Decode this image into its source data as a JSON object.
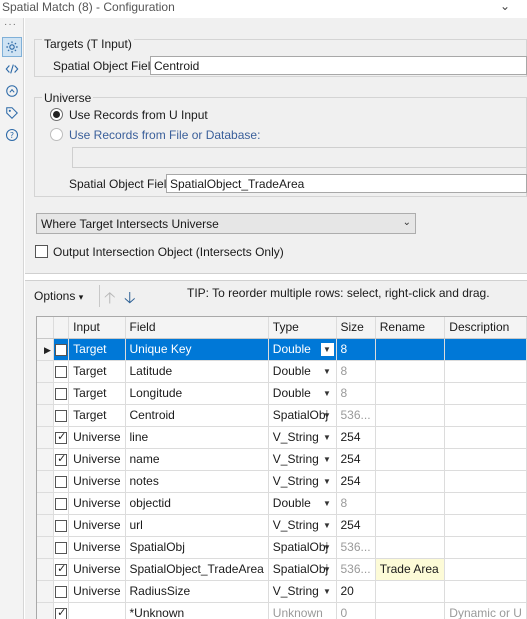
{
  "window": {
    "title": "Spatial Match (8) - Configuration"
  },
  "sidebar": {
    "icons": [
      "gear-icon",
      "code-icon",
      "help-circle-icon",
      "tag-icon",
      "question-icon"
    ]
  },
  "targets": {
    "group_title": "Targets (T Input)",
    "field_label": "Spatial Object Field:",
    "field_value": "Centroid"
  },
  "universe": {
    "group_title": "Universe",
    "option_u_input": "Use Records from U Input",
    "option_file": "Use Records from File or Database:",
    "file_value": "",
    "field_label": "Spatial Object Field:",
    "field_value": "SpatialObject_TradeArea"
  },
  "match_type": {
    "selected": "Where Target Intersects Universe"
  },
  "output_intersection": {
    "label": "Output Intersection Object (Intersects Only)",
    "checked": false
  },
  "toolbar": {
    "options_label": "Options",
    "tip": "TIP: To reorder multiple rows: select, right-click and drag."
  },
  "table": {
    "columns": [
      "Input",
      "Field",
      "Type",
      "Size",
      "Rename",
      "Description"
    ],
    "rows": [
      {
        "checked": false,
        "input": "Target",
        "field": "Unique Key",
        "type": "Double",
        "size": "8",
        "rename": "",
        "description": "",
        "selected": true
      },
      {
        "checked": false,
        "input": "Target",
        "field": "Latitude",
        "type": "Double",
        "size": "8",
        "rename": "",
        "description": ""
      },
      {
        "checked": false,
        "input": "Target",
        "field": "Longitude",
        "type": "Double",
        "size": "8",
        "rename": "",
        "description": ""
      },
      {
        "checked": false,
        "input": "Target",
        "field": "Centroid",
        "type": "SpatialObj",
        "size": "536...",
        "rename": "",
        "description": ""
      },
      {
        "checked": true,
        "input": "Universe",
        "field": "line",
        "type": "V_String",
        "size": "254",
        "rename": "",
        "description": ""
      },
      {
        "checked": true,
        "input": "Universe",
        "field": "name",
        "type": "V_String",
        "size": "254",
        "rename": "",
        "description": ""
      },
      {
        "checked": false,
        "input": "Universe",
        "field": "notes",
        "type": "V_String",
        "size": "254",
        "rename": "",
        "description": ""
      },
      {
        "checked": false,
        "input": "Universe",
        "field": "objectid",
        "type": "Double",
        "size": "8",
        "rename": "",
        "description": ""
      },
      {
        "checked": false,
        "input": "Universe",
        "field": "url",
        "type": "V_String",
        "size": "254",
        "rename": "",
        "description": ""
      },
      {
        "checked": false,
        "input": "Universe",
        "field": "SpatialObj",
        "type": "SpatialObj",
        "size": "536...",
        "rename": "",
        "description": ""
      },
      {
        "checked": true,
        "input": "Universe",
        "field": "SpatialObject_TradeArea",
        "type": "SpatialObj",
        "size": "536...",
        "rename": "Trade Area",
        "description": ""
      },
      {
        "checked": false,
        "input": "Universe",
        "field": "RadiusSize",
        "type": "V_String",
        "size": "20",
        "rename": "",
        "description": ""
      },
      {
        "checked": true,
        "input": "",
        "field": "*Unknown",
        "type": "Unknown",
        "size": "0",
        "rename": "",
        "description": "Dynamic or U"
      }
    ]
  }
}
